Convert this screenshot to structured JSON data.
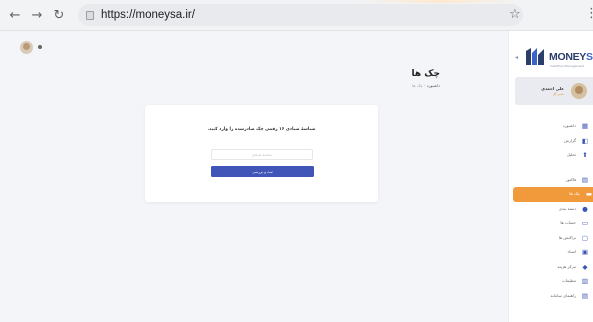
{
  "browser": {
    "url": "https://moneysa.ir/",
    "back_icon": "←",
    "forward_icon": "→",
    "reload_icon": "↻",
    "star_icon": "☆",
    "menu_icon": "⋮"
  },
  "page": {
    "title": "چک ها",
    "breadcrumb_home": "داشبورد",
    "breadcrumb_sep": "-",
    "breadcrumb_current": "چک ها"
  },
  "card": {
    "message": "شناسهٔ صیادی ۱۶ رقمی چک صادرشده را وارد کنید.",
    "input_placeholder": "شناسهٔ صیادی",
    "button_label": "ثبت و بررسی"
  },
  "sidebar": {
    "logo_main": "MONEY",
    "logo_accent": "SA",
    "logo_sub": "Cashflow Management",
    "user_name": "علی احمدی",
    "user_role": "مدیر کل",
    "items": [
      {
        "label": "داشبورد",
        "icon": "▦",
        "icon_name": "dashboard-icon"
      },
      {
        "label": "گزارش",
        "icon": "◧",
        "icon_name": "report-icon"
      },
      {
        "label": "تحلیل",
        "icon": "⬆",
        "icon_name": "analysis-icon"
      },
      {
        "label": "فاکتور",
        "icon": "▤",
        "icon_name": "invoice-icon"
      },
      {
        "label": "چک ها",
        "icon": "▬",
        "icon_name": "check-icon",
        "active": true
      },
      {
        "label": "دسته بندی",
        "icon": "●",
        "icon_name": "category-icon"
      },
      {
        "label": "حساب ها",
        "icon": "▭",
        "icon_name": "account-icon"
      },
      {
        "label": "تراکنش ها",
        "icon": "▢",
        "icon_name": "transaction-icon"
      },
      {
        "label": "اسناد",
        "icon": "▣",
        "icon_name": "document-icon"
      },
      {
        "label": "مرکز هزینه",
        "icon": "◆",
        "icon_name": "cost-center-icon"
      },
      {
        "label": "تنظیمات",
        "icon": "▥",
        "icon_name": "settings-icon"
      },
      {
        "label": "راهنمای سامانه",
        "icon": "▤",
        "icon_name": "help-icon"
      }
    ]
  }
}
